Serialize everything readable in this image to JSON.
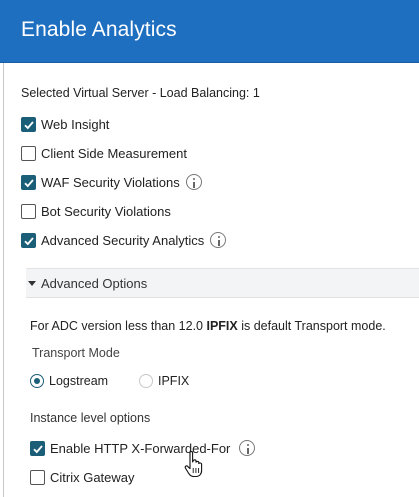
{
  "header": {
    "title": "Enable Analytics"
  },
  "selected_server": {
    "label": "Selected Virtual Server - Load Balancing: 1"
  },
  "options": [
    {
      "label": "Web Insight",
      "checked": true,
      "info": false
    },
    {
      "label": "Client Side Measurement",
      "checked": false,
      "info": false
    },
    {
      "label": "WAF Security Violations",
      "checked": true,
      "info": true
    },
    {
      "label": "Bot Security Violations",
      "checked": false,
      "info": false
    },
    {
      "label": "Advanced Security Analytics",
      "checked": true,
      "info": true
    }
  ],
  "advanced": {
    "label": "Advanced Options",
    "expanded": true,
    "note_prefix": "For ADC version less than 12.0 ",
    "note_bold": "IPFIX",
    "note_suffix": " is default Transport mode.",
    "transport_mode_label": "Transport Mode",
    "transport_options": [
      {
        "label": "Logstream",
        "selected": true
      },
      {
        "label": "IPFIX",
        "selected": false
      }
    ],
    "instance_label": "Instance level options",
    "instance_options": [
      {
        "label": "Enable HTTP X-Forwarded-For",
        "checked": true,
        "info": true
      },
      {
        "label": "Citrix Gateway",
        "checked": false,
        "info": false
      }
    ]
  },
  "colors": {
    "header_bg": "#1f6fc1",
    "accent": "#1b5e78"
  }
}
